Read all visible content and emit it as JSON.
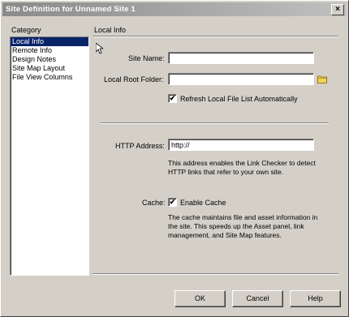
{
  "window": {
    "title": "Site Definition for Unnamed Site 1",
    "close_glyph": "×"
  },
  "category": {
    "label": "Category",
    "items": [
      "Local Info",
      "Remote Info",
      "Design Notes",
      "Site Map Layout",
      "File View Columns"
    ],
    "selected": "Local Info"
  },
  "local_info": {
    "section_title": "Local Info",
    "site_name_label": "Site Name:",
    "site_name_value": "",
    "local_root_label": "Local Root Folder:",
    "local_root_value": "",
    "refresh_label": "Refresh Local File List Automatically",
    "refresh_checked": true,
    "http_label": "HTTP Address:",
    "http_value": "http://",
    "http_help": "This address enables the Link Checker to detect HTTP links that refer to your own site.",
    "cache_label": "Cache:",
    "enable_cache_label": "Enable Cache",
    "cache_checked": true,
    "cache_help": "The cache maintains file and asset information in the site.  This speeds up the Asset panel, link management, and Site Map features."
  },
  "buttons": {
    "ok": "OK",
    "cancel": "Cancel",
    "help": "Help"
  },
  "check_glyph": "✔",
  "icons": {
    "folder": "folder-icon",
    "cursor": "cursor-icon"
  },
  "colors": {
    "selection": "#0a246a",
    "dialog": "#d4d0c8",
    "folder": "#f2d35c"
  }
}
